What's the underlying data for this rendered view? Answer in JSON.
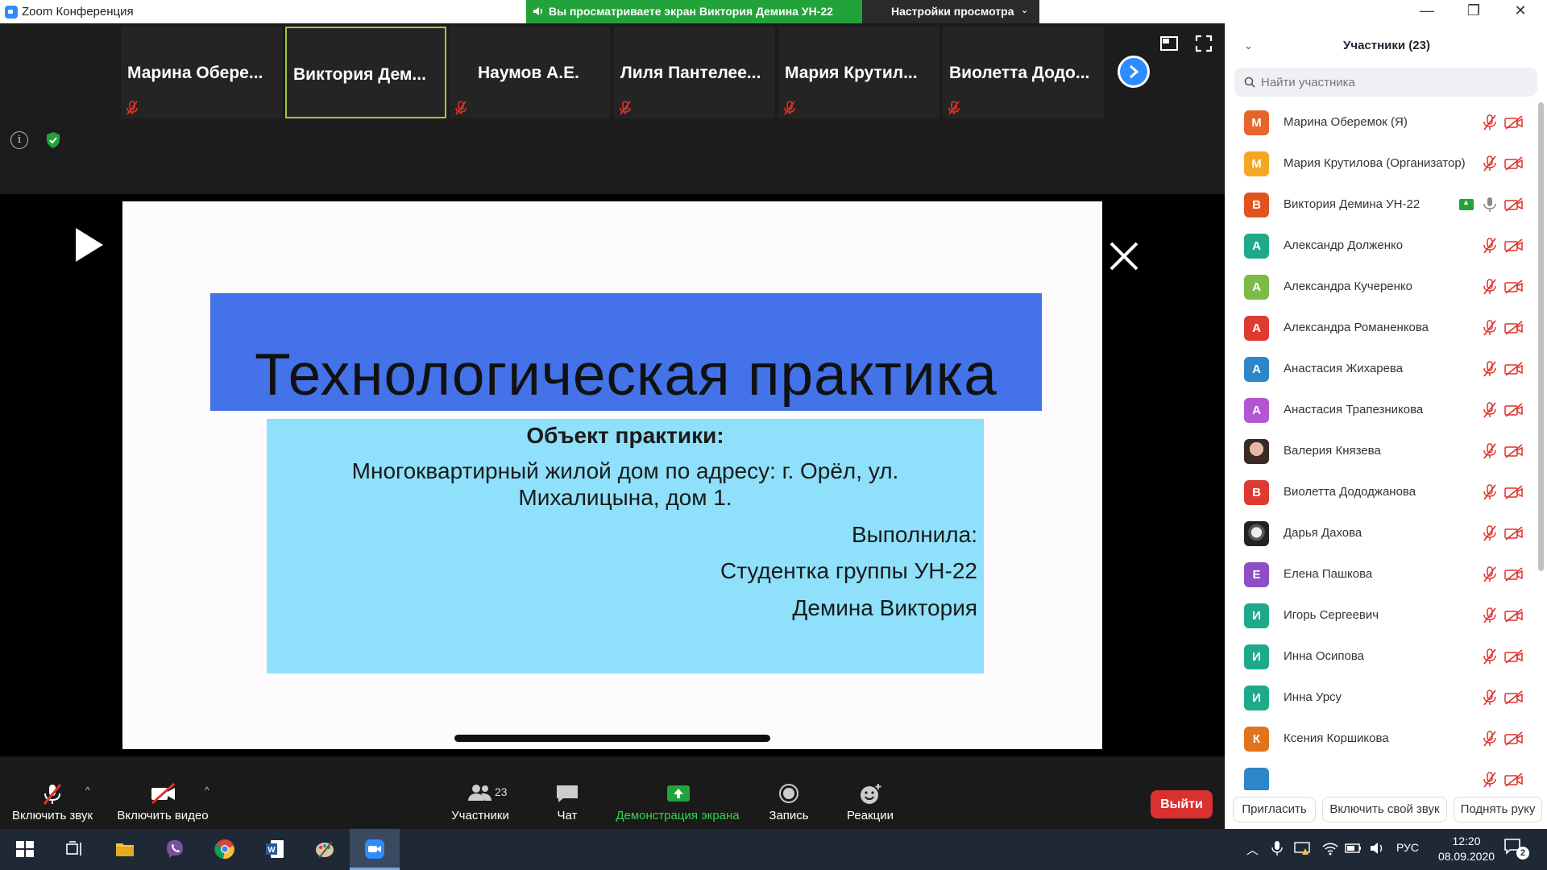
{
  "window": {
    "title": "Zoom Конференция",
    "share_banner": "Вы просматриваете экран Виктория Демина УН-22",
    "view_settings": "Настройки просмотра",
    "minimize": "—",
    "maximize": "❐",
    "close": "✕"
  },
  "thumbnails": [
    {
      "name": "Марина  Обере...",
      "muted": true,
      "active": false
    },
    {
      "name": "Виктория  Дем...",
      "muted": false,
      "active": true
    },
    {
      "name": "Наумов А.Е.",
      "muted": true,
      "active": false
    },
    {
      "name": "Лиля  Пантелее...",
      "muted": true,
      "active": false
    },
    {
      "name": "Мария  Крутил...",
      "muted": true,
      "active": false
    },
    {
      "name": "Виолетта  Додо...",
      "muted": true,
      "active": false
    }
  ],
  "info_glyph": "i",
  "slide": {
    "title": "Технологическая практика",
    "object_heading": "Объект практики:",
    "address": "Многоквартирный жилой дом по адресу: г. Орёл, ул. Михалицына, дом 1.",
    "done_by": "Выполнила:",
    "group": "Студентка группы УН-22",
    "author": "Демина Виктория"
  },
  "toolbar": {
    "audio_label": "Включить звук",
    "video_label": "Включить видео",
    "participants_label": "Участники",
    "participants_count": "23",
    "chat_label": "Чат",
    "share_label": "Демонстрация экрана",
    "record_label": "Запись",
    "reactions_label": "Реакции",
    "leave_label": "Выйти",
    "caret": "^"
  },
  "panel": {
    "title": "Участники (23)",
    "collapse": "⌄",
    "search_placeholder": "Найти участника",
    "participants": [
      {
        "initial": "М",
        "color": "#e8642a",
        "name": "Марина Оберемок (Я)",
        "mic": "muted",
        "sharing": false
      },
      {
        "initial": "М",
        "color": "#f5a623",
        "name": "Мария Крутилова (Организатор)",
        "mic": "muted",
        "sharing": false
      },
      {
        "initial": "В",
        "color": "#e0541c",
        "name": "Виктория Демина УН-22",
        "mic": "on",
        "sharing": true
      },
      {
        "initial": "А",
        "color": "#1eaa8a",
        "name": "Александр Долженко",
        "mic": "muted",
        "sharing": false
      },
      {
        "initial": "А",
        "color": "#7cbb45",
        "name": "Александра Кучеренко",
        "mic": "muted",
        "sharing": false
      },
      {
        "initial": "А",
        "color": "#dd3b32",
        "name": "Александра Романенкова",
        "mic": "muted",
        "sharing": false
      },
      {
        "initial": "А",
        "color": "#2d86c7",
        "name": "Анастасия Жихарева",
        "mic": "muted",
        "sharing": false
      },
      {
        "initial": "А",
        "color": "#b456d4",
        "name": "Анастасия Трапезникова",
        "mic": "muted",
        "sharing": false
      },
      {
        "initial": "",
        "color": "photo1",
        "name": "Валерия Князева",
        "mic": "muted",
        "sharing": false
      },
      {
        "initial": "В",
        "color": "#dd3b32",
        "name": "Виолетта Дододжанова",
        "mic": "muted",
        "sharing": false
      },
      {
        "initial": "",
        "color": "photo2",
        "name": "Дарья Дахова",
        "mic": "muted",
        "sharing": false
      },
      {
        "initial": "Е",
        "color": "#8e4fc4",
        "name": "Елена Пашкова",
        "mic": "muted",
        "sharing": false
      },
      {
        "initial": "И",
        "color": "#1eaa8a",
        "name": "Игорь Сергеевич",
        "mic": "muted",
        "sharing": false
      },
      {
        "initial": "И",
        "color": "#1eaa8a",
        "name": "Инна Осипова",
        "mic": "muted",
        "sharing": false
      },
      {
        "initial": "И",
        "color": "#1eaa8a",
        "name": "Инна Урсу",
        "mic": "muted",
        "sharing": false
      },
      {
        "initial": "К",
        "color": "#e0741c",
        "name": "Ксения Коршикова",
        "mic": "muted",
        "sharing": false
      },
      {
        "initial": "",
        "color": "#2d86c7",
        "name": "",
        "mic": "muted",
        "sharing": false
      }
    ],
    "invite_label": "Пригласить",
    "unmute_self_label": "Включить свой звук",
    "raise_hand_label": "Поднять руку"
  },
  "taskbar": {
    "language": "РУС",
    "time": "12:20",
    "date": "08.09.2020",
    "notifications": "2"
  },
  "colors": {
    "accent": "#2d8cff",
    "share_green": "#22a33a",
    "leave_red": "#d93030",
    "muted_red": "#e0322c"
  }
}
